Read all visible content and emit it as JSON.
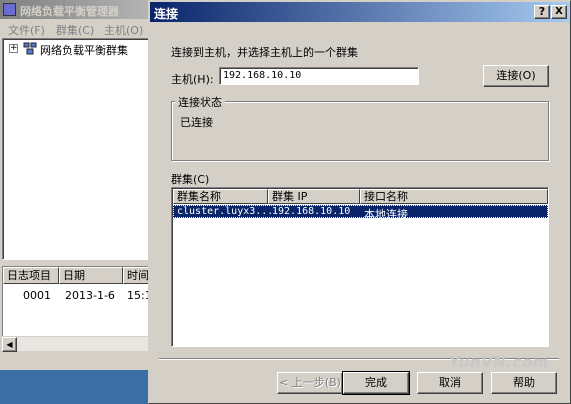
{
  "bg_window": {
    "title": "网络负载平衡管理器",
    "menu": [
      "文件(F)",
      "群集(C)",
      "主机(O)"
    ],
    "tree_root": "网络负载平衡群集",
    "log_headers": [
      "日志项目",
      "日期",
      "时间"
    ],
    "log_rows": [
      {
        "id": "0001",
        "date": "2013-1-6",
        "time": "15:1"
      }
    ]
  },
  "dialog": {
    "title": "连接",
    "help_btn": "?",
    "close_btn": "X",
    "instruction": "连接到主机，并选择主机上的一个群集",
    "host_label": "主机(H):",
    "host_value": "192.168.10.10",
    "connect_btn": "连接(O)",
    "status_group": "连接状态",
    "status_text": "已连接",
    "clusters_label": "群集(C)",
    "columns": [
      "群集名称",
      "群集 IP",
      "接口名称"
    ],
    "rows": [
      {
        "name": "cluster.luyx3...",
        "ip": "192.168.10.10",
        "iface": "本地连接"
      }
    ],
    "buttons": {
      "back": "< 上一步(B)",
      "finish": "完成",
      "cancel": "取消",
      "help": "帮助"
    }
  },
  "watermark": "YunVN.com",
  "colors": {
    "active_title": "#0a246a",
    "selection": "#0a246a",
    "face": "#d4d0c8",
    "taskbar": "#3a6ea5"
  }
}
